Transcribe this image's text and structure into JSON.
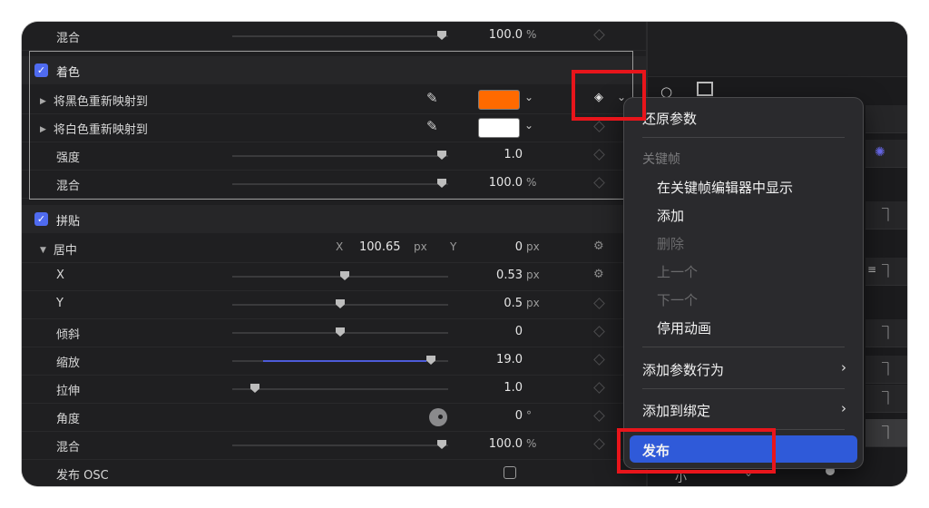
{
  "inspector": {
    "top_mix": {
      "label": "混合",
      "value": "100.0",
      "unit": "%",
      "level": 0.98
    },
    "colorize": {
      "title": "着色",
      "map_black": {
        "label": "将黑色重新映射到",
        "swatch": "#ff6a00"
      },
      "map_white": {
        "label": "将白色重新映射到",
        "swatch": "#ffffff"
      },
      "intensity": {
        "label": "强度",
        "value": "1.0",
        "level": 0.98
      },
      "mix": {
        "label": "混合",
        "value": "100.0",
        "unit": "%",
        "level": 0.98
      }
    },
    "tile": {
      "title": "拼贴",
      "center": {
        "label": "居中",
        "x_label": "X",
        "x_value": "100.65",
        "x_unit": "px",
        "y_label": "Y",
        "y_value": "0",
        "y_unit": "px"
      },
      "x": {
        "label": "X",
        "value": "0.53",
        "unit": "px",
        "level": 0.52
      },
      "y": {
        "label": "Y",
        "value": "0.5",
        "unit": "px",
        "level": 0.5
      },
      "skew": {
        "label": "倾斜",
        "value": "0",
        "level": 0.5
      },
      "scale": {
        "label": "缩放",
        "value": "19.0",
        "level": 0.93
      },
      "stretch": {
        "label": "拉伸",
        "value": "1.0",
        "level": 0.1
      },
      "angle": {
        "label": "角度",
        "value": "0",
        "unit": "°"
      },
      "mix": {
        "label": "混合",
        "value": "100.0",
        "unit": "%",
        "level": 0.98
      },
      "publish_osc": {
        "label": "发布 OSC"
      }
    }
  },
  "context_menu": {
    "reset": "还原参数",
    "keyframes_header": "关键帧",
    "show_in_editor": "在关键帧编辑器中显示",
    "add": "添加",
    "delete": "删除",
    "previous": "上一个",
    "next": "下一个",
    "disable_animation": "停用动画",
    "add_behavior": "添加参数行为",
    "add_to_rig": "添加到绑定",
    "publish": "发布"
  },
  "right_panel": {
    "size_label": "小"
  },
  "colors": {
    "accent": "#4f6bf0",
    "highlight": "#2f5ad9",
    "annotation": "#e8151b"
  }
}
